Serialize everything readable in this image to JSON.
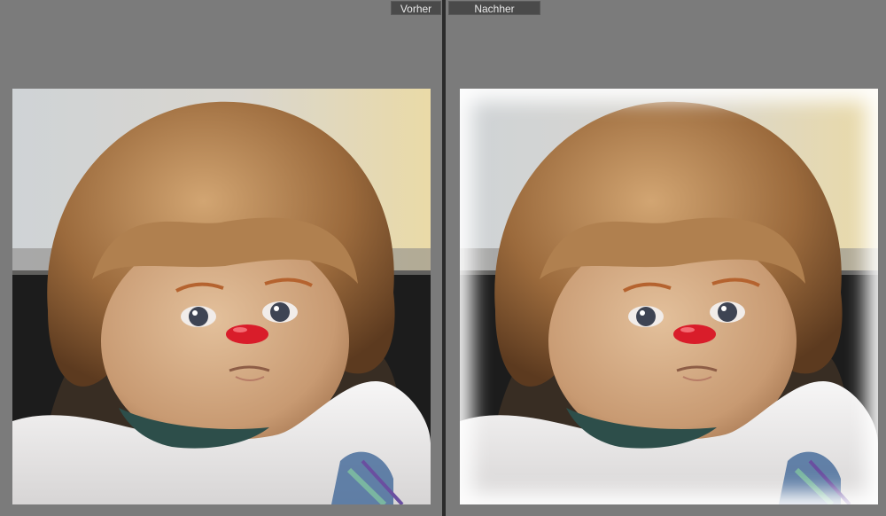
{
  "compare_view": {
    "before_label": "Vorher",
    "after_label": "Nachher"
  },
  "photo": {
    "subject": "doll",
    "icon_name": "doll-portrait",
    "colors": {
      "hair": "#a8774a",
      "skin": "#caa07c",
      "nose": "#d91d2a",
      "collar": "#ecebeb",
      "background_dark": "#1c1c1c",
      "background_light": "#d8cda7"
    }
  }
}
